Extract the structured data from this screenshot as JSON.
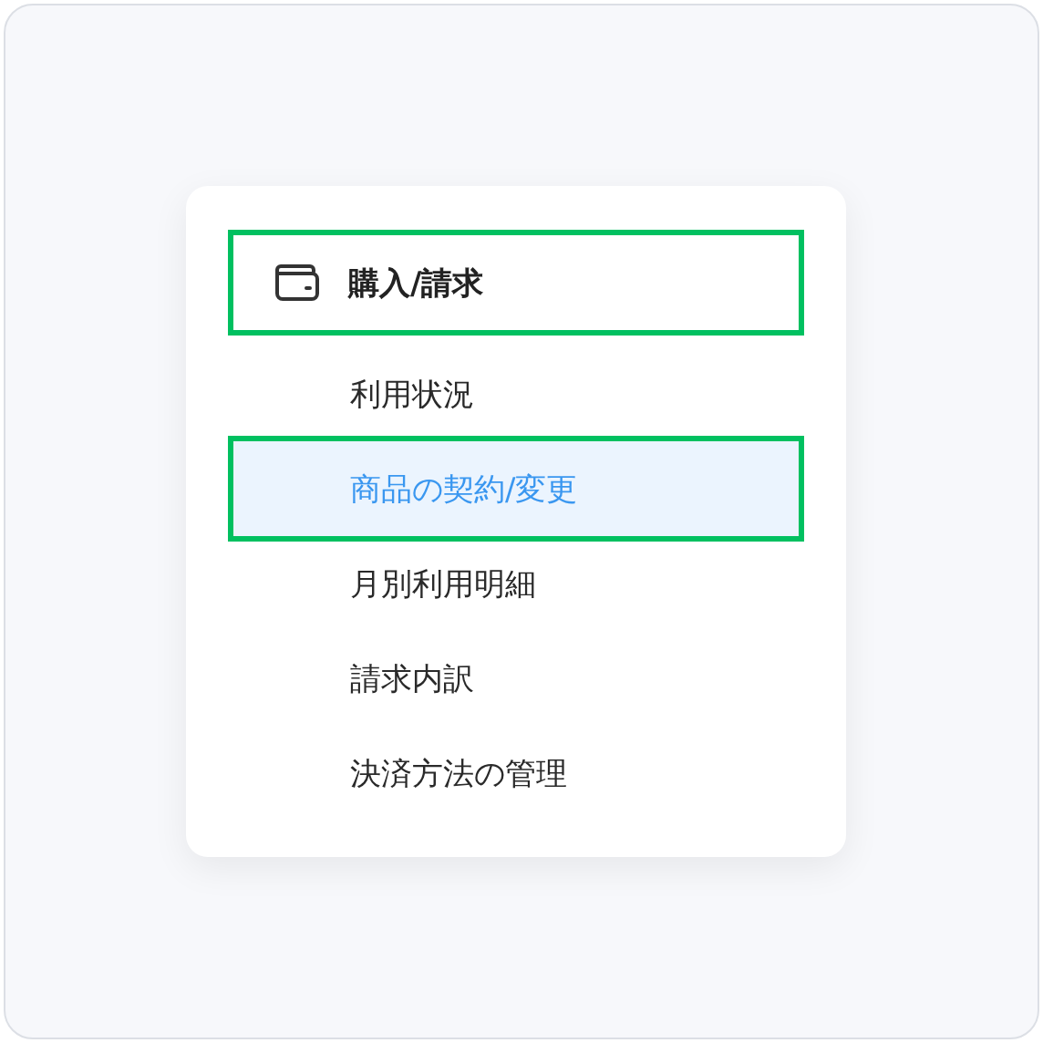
{
  "section": {
    "title": "購入/請求",
    "highlighted": true
  },
  "items": [
    {
      "label": "利用状況",
      "selected": false,
      "highlighted": false
    },
    {
      "label": "商品の契約/変更",
      "selected": true,
      "highlighted": true
    },
    {
      "label": "月別利用明細",
      "selected": false,
      "highlighted": false
    },
    {
      "label": "請求内訳",
      "selected": false,
      "highlighted": false
    },
    {
      "label": "決済方法の管理",
      "selected": false,
      "highlighted": false
    }
  ]
}
